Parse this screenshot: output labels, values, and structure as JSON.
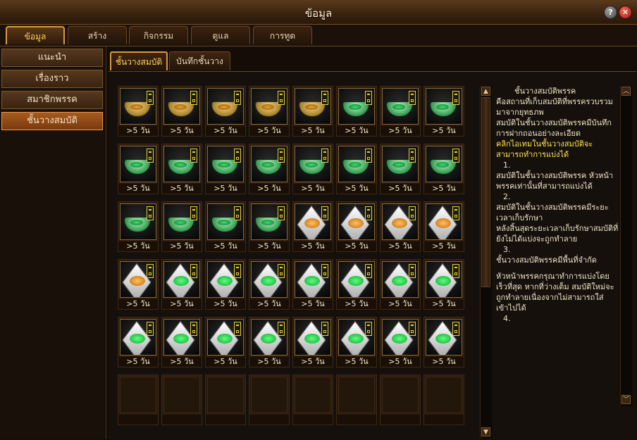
{
  "window": {
    "title": "ข้อมูล"
  },
  "tabs": [
    "ข้อมูล",
    "สร้าง",
    "กิจกรรม",
    "ดูแล",
    "การทูต"
  ],
  "sidebar": {
    "items": [
      "แนะนำ",
      "เรื่องราว",
      "สมาชิกพรรค",
      "ชั้นวางสมบัติ"
    ]
  },
  "subtabs": [
    "ชั้นวางสมบัติ",
    "บันทึกชั้นวางส..."
  ],
  "grid": {
    "rows": [
      [
        {
          "item": "gold-bowl",
          "label": ">5 วัน"
        },
        {
          "item": "gold-bowl",
          "label": ">5 วัน"
        },
        {
          "item": "gold-bowl",
          "label": ">5 วัน"
        },
        {
          "item": "gold-bowl",
          "label": ">5 วัน"
        },
        {
          "item": "gold-bowl",
          "label": ">5 วัน"
        },
        {
          "item": "jade-bowl",
          "label": ">5 วัน"
        },
        {
          "item": "jade-bowl",
          "label": ">5 วัน"
        },
        {
          "item": "jade-bowl",
          "label": ">5 วัน"
        }
      ],
      [
        {
          "item": "jade-bowl",
          "label": ">5 วัน"
        },
        {
          "item": "jade-bowl",
          "label": ">5 วัน"
        },
        {
          "item": "jade-bowl",
          "label": ">5 วัน"
        },
        {
          "item": "jade-bowl",
          "label": ">5 วัน"
        },
        {
          "item": "jade-bowl",
          "label": ">5 วัน"
        },
        {
          "item": "jade-bowl",
          "label": ">5 วัน"
        },
        {
          "item": "jade-bowl",
          "label": ">5 วัน"
        },
        {
          "item": "jade-bowl",
          "label": ">5 วัน"
        }
      ],
      [
        {
          "item": "jade-bowl",
          "label": ">5 วัน"
        },
        {
          "item": "jade-bowl",
          "label": ">5 วัน"
        },
        {
          "item": "jade-bowl",
          "label": ">5 วัน"
        },
        {
          "item": "jade-bowl",
          "label": ">5 วัน"
        },
        {
          "item": "amber-cloth",
          "label": ">5 วัน"
        },
        {
          "item": "amber-cloth",
          "label": ">5 วัน"
        },
        {
          "item": "amber-cloth",
          "label": ">5 วัน"
        },
        {
          "item": "amber-cloth",
          "label": ">5 วัน"
        }
      ],
      [
        {
          "item": "amber-cloth",
          "label": ">5 วัน"
        },
        {
          "item": "green-cloth",
          "label": ">5 วัน"
        },
        {
          "item": "green-cloth",
          "label": ">5 วัน"
        },
        {
          "item": "green-cloth",
          "label": ">5 วัน"
        },
        {
          "item": "green-cloth",
          "label": ">5 วัน"
        },
        {
          "item": "green-cloth",
          "label": ">5 วัน"
        },
        {
          "item": "green-cloth",
          "label": ">5 วัน"
        },
        {
          "item": "green-cloth",
          "label": ">5 วัน"
        }
      ],
      [
        {
          "item": "green-cloth",
          "label": ">5 วัน"
        },
        {
          "item": "green-cloth",
          "label": ">5 วัน"
        },
        {
          "item": "green-cloth",
          "label": ">5 วัน"
        },
        {
          "item": "green-cloth",
          "label": ">5 วัน"
        },
        {
          "item": "green-cloth",
          "label": ">5 วัน"
        },
        {
          "item": "green-cloth",
          "label": ">5 วัน"
        },
        {
          "item": "green-cloth",
          "label": ">5 วัน"
        },
        {
          "item": "green-cloth",
          "label": ">5 วัน"
        }
      ],
      [
        {
          "item": "empty",
          "label": ""
        },
        {
          "item": "empty",
          "label": ""
        },
        {
          "item": "empty",
          "label": ""
        },
        {
          "item": "empty",
          "label": ""
        },
        {
          "item": "empty",
          "label": ""
        },
        {
          "item": "empty",
          "label": ""
        },
        {
          "item": "empty",
          "label": ""
        },
        {
          "item": "empty",
          "label": ""
        }
      ]
    ]
  },
  "description": {
    "title": "ชั้นวางสมบัติพรรค",
    "intro": "คือสถานที่เก็บสมบัติที่พรรครวบรวมมาจากยุทธภพ",
    "record": "สมบัติในชั้นวางสมบัติพรรคมีบันทึกการฝากถอนอย่างละเอียด",
    "highlight": "คลิกไอเทมในชั้นวางสมบัติจะสามารถทำการแบ่งได้",
    "n1": "1.",
    "p1": "สมบัติในชั้นวางสมบัติพรรค หัวหน้าพรรคเท่านั้นที่สามารถแบ่งได้",
    "n2": "2.",
    "p2a": "สมบัติในชั้นวางสมบัติพรรคมีระยะเวลาเก็บรักษา",
    "p2b": "หลังสิ้นสุดระยะเวลาเก็บรักษาสมบัติที่ยังไม่ได้แบ่งจะถูกทำลาย",
    "n3": "3.",
    "p3": "ชั้นวางสมบัติพรรคมีพื้นที่จำกัด",
    "p3b": "หัวหน้าพรรคกรุณาทำการแบ่งโดยเร็วที่สุด หากที่ว่างเต็ม สมบัติใหม่จะถูกทำลายเนื่องจากไม่สามารถใส่เข้าไปได้",
    "n4": "4."
  }
}
